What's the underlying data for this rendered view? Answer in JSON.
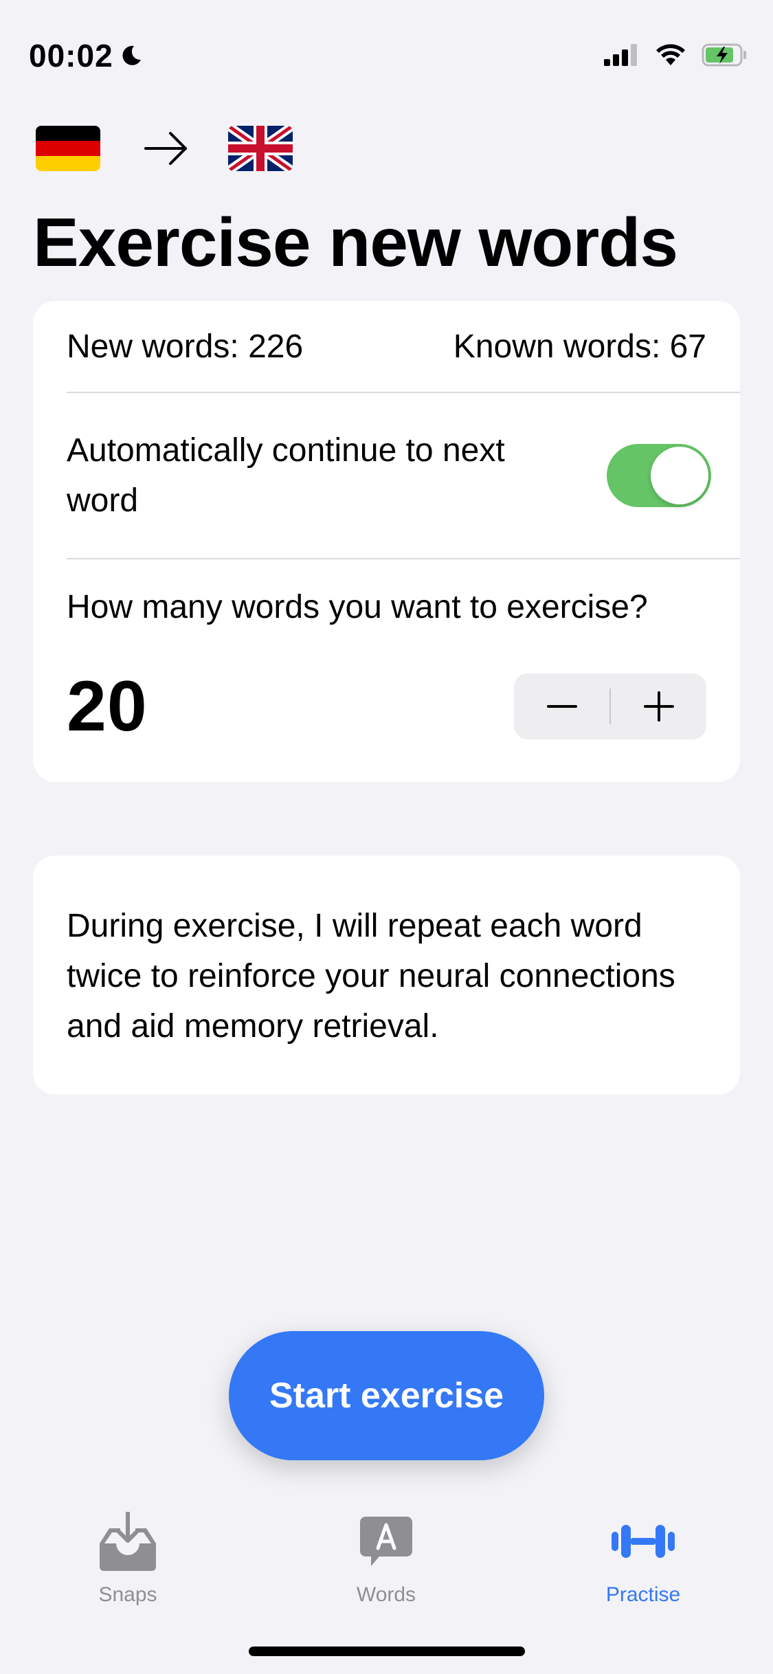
{
  "status_bar": {
    "time": "00:02"
  },
  "languages": {
    "source": "German",
    "target": "English (UK)"
  },
  "page_title": "Exercise new words",
  "stats": {
    "new_words_label": "New words: 226",
    "known_words_label": "Known words: 67"
  },
  "settings": {
    "auto_continue_label": "Automatically continue to next word",
    "auto_continue_on": true,
    "question": "How many words you want to exercise?",
    "word_count": "20"
  },
  "info": {
    "text": "During exercise, I will repeat each word twice to reinforce your neural connections and aid memory retrieval."
  },
  "start_button": {
    "label": "Start exercise"
  },
  "tabs": [
    {
      "label": "Snaps",
      "icon": "tray-download-icon",
      "active": false
    },
    {
      "label": "Words",
      "icon": "speech-bubble-a-icon",
      "active": false
    },
    {
      "label": "Practise",
      "icon": "dumbbell-icon",
      "active": true
    }
  ],
  "colors": {
    "accent": "#3478f6",
    "toggle_on": "#65c466",
    "background": "#f2f2f7",
    "inactive_tab": "#8e8e93"
  }
}
